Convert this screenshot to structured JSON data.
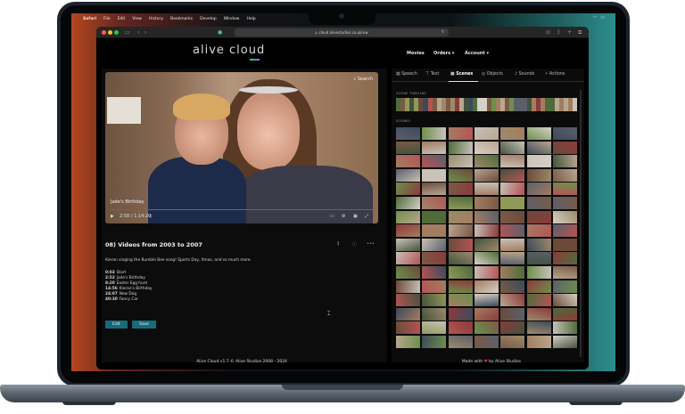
{
  "menubar": {
    "items": [
      "Safari",
      "File",
      "Edit",
      "View",
      "History",
      "Bookmarks",
      "Develop",
      "Window",
      "Help"
    ]
  },
  "browser": {
    "url": "cloud.alivestudios.co.uk/uw"
  },
  "site": {
    "logo": "alive cloud",
    "nav": {
      "movies": "Movies",
      "orders": "Orders ▾",
      "account": "Account ▾"
    }
  },
  "player": {
    "search_label": "Search",
    "caption": "Jade's Birthday",
    "time": "2:58 / 1:14:20"
  },
  "video": {
    "title": "08) Videos from 2003 to 2007",
    "description": "Kieran singing the Bumble Bee song! Sports Day, Xmas, and so much more.",
    "chapters": [
      {
        "time": "0:03",
        "label": "Start"
      },
      {
        "time": "2:52",
        "label": "Jade's Birthday"
      },
      {
        "time": "8:20",
        "label": "Easter Egg hunt"
      },
      {
        "time": "14:56",
        "label": "Kieran's Birthday"
      },
      {
        "time": "24:07",
        "label": "New Dog"
      },
      {
        "time": "40:30",
        "label": "Fancy Car"
      }
    ],
    "edit_label": "Edit",
    "save_label": "Save"
  },
  "panel": {
    "tabs": [
      "Speech",
      "Text",
      "Scenes",
      "Objects",
      "Sounds",
      "Actions"
    ],
    "active_tab": "Scenes",
    "timeline_label": "SCENE TIMELINE",
    "scenes_label": "SCENES"
  },
  "footer": {
    "left": "Alive Cloud v1.7 © Alive Studios 2008 - 2024",
    "right_prefix": "Made with",
    "heart": "♥",
    "right_suffix": "by Alive Studios"
  },
  "colors": {
    "accent": "#176b78",
    "page_bg": "#000000"
  }
}
